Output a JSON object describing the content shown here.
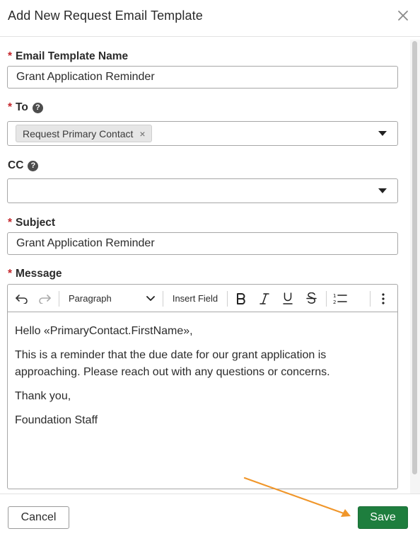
{
  "dialog": {
    "title": "Add New Request Email Template"
  },
  "fields": {
    "template_name": {
      "label": "Email Template Name",
      "required_mark": "*",
      "value": "Grant Application Reminder"
    },
    "to": {
      "label": "To",
      "required_mark": "*",
      "help": "?",
      "chip": "Request Primary Contact",
      "chip_remove": "×"
    },
    "cc": {
      "label": "CC",
      "help": "?",
      "value": ""
    },
    "subject": {
      "label": "Subject",
      "required_mark": "*",
      "value": "Grant Application Reminder"
    },
    "message": {
      "label": "Message",
      "required_mark": "*"
    }
  },
  "toolbar": {
    "paragraph_label": "Paragraph",
    "insert_field_label": "Insert Field",
    "icons": [
      "undo-icon",
      "redo-icon",
      "chevron-down-icon",
      "bold-icon",
      "italic-icon",
      "underline-icon",
      "strikethrough-icon",
      "numbered-list-icon",
      "more-vertical-icon"
    ]
  },
  "message_body": [
    "Hello «PrimaryContact.FirstName»,",
    "This is a reminder that the due date for our grant application is approaching. Please reach out with any questions or concerns.",
    "Thank you,",
    "Foundation Staff"
  ],
  "footer": {
    "cancel_label": "Cancel",
    "save_label": "Save"
  },
  "colors": {
    "required": "#c4272c",
    "save_button": "#1e7e3e",
    "annotation_arrow": "#f0962a"
  }
}
